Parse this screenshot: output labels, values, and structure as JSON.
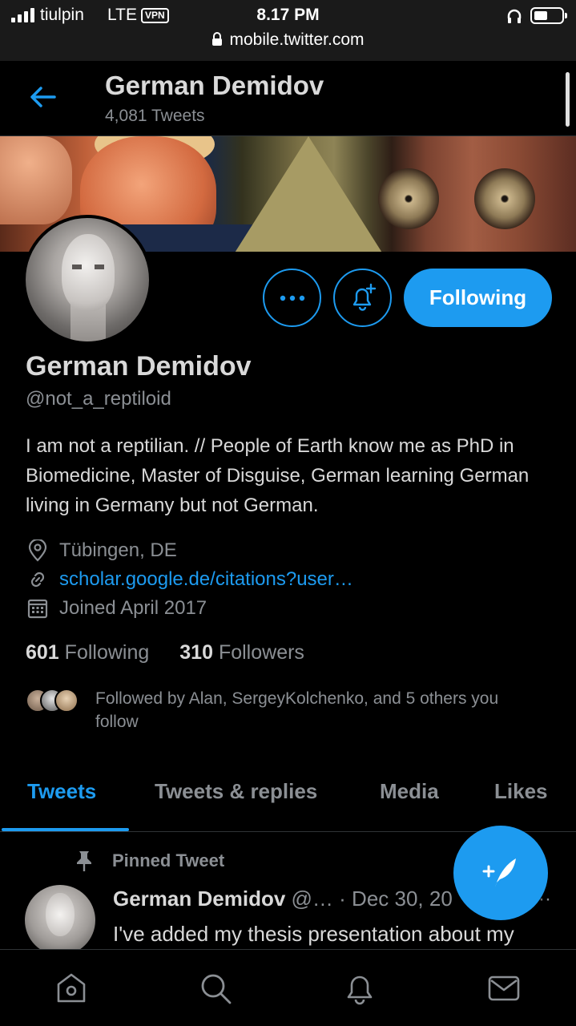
{
  "statusbar": {
    "carrier": "tiulpin",
    "network": "LTE",
    "vpn": "VPN",
    "time": "8.17 PM",
    "url": "mobile.twitter.com"
  },
  "header": {
    "name": "German Demidov",
    "tweet_count": "4,081 Tweets"
  },
  "profile": {
    "name": "German Demidov",
    "handle": "@not_a_reptiloid",
    "bio": "I am not a reptilian. // People of Earth know me as PhD in Biomedicine, Master of Disguise, German learning German living in Germany but not German.",
    "follow_button": "Following",
    "location": "Tübingen, DE",
    "link": "scholar.google.de/citations?user…",
    "joined": "Joined April 2017",
    "following_count": "601",
    "following_label": "Following",
    "followers_count": "310",
    "followers_label": "Followers",
    "followed_by": "Followed by Alan, SergeyKolchenko, and 5 others you follow"
  },
  "tabs": [
    {
      "label": "Tweets",
      "active": true
    },
    {
      "label": "Tweets & replies",
      "active": false
    },
    {
      "label": "Media",
      "active": false
    },
    {
      "label": "Likes",
      "active": false
    }
  ],
  "tweet": {
    "pinned_label": "Pinned Tweet",
    "author": "German Demidov",
    "handle": "@…",
    "date": "· Dec 30, 20",
    "text": "I've added my thesis presentation about my",
    "more": "···"
  },
  "colors": {
    "accent": "#1d9bf0",
    "background": "#000000",
    "text": "#d9d9d9",
    "muted": "#8b8f94"
  },
  "icons": [
    "back-arrow-icon",
    "more-icon",
    "bell-plus-icon",
    "location-pin-icon",
    "link-icon",
    "calendar-icon",
    "pin-icon",
    "compose-tweet-icon",
    "home-icon",
    "search-icon",
    "notifications-icon",
    "messages-icon"
  ]
}
